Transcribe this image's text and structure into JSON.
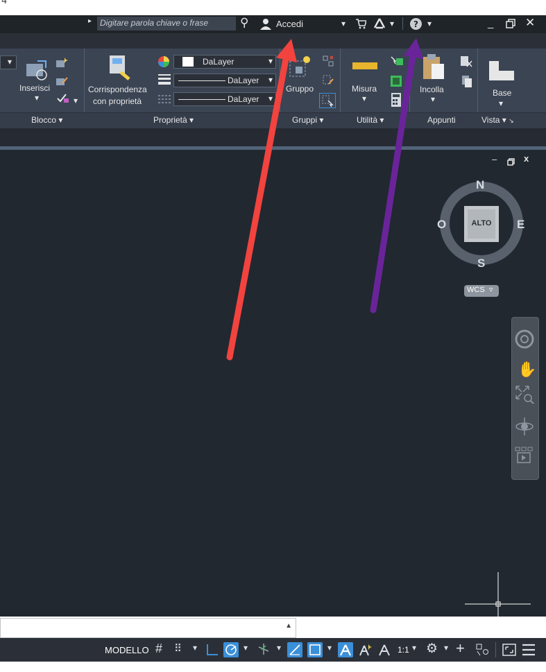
{
  "corner_text": "4",
  "titlebar": {
    "search_placeholder": "Digitare parola chiave o frase",
    "signin_label": "Accedi"
  },
  "ribbon": {
    "insert_label": "Inserisci",
    "match_props_line1": "Corrispondenza",
    "match_props_line2": "con proprietà",
    "layer_color_value": "DaLayer",
    "linetype_value": "DaLayer",
    "lineweight_value": "DaLayer",
    "group_label": "Gruppo",
    "measure_label": "Misura",
    "paste_label": "Incolla",
    "base_label": "Base"
  },
  "panels": {
    "block": "Blocco",
    "properties": "Proprietà",
    "groups": "Gruppi",
    "utilities": "Utilità",
    "clipboard": "Appunti",
    "view": "Vista"
  },
  "viewcube": {
    "north": "N",
    "south": "S",
    "east": "E",
    "west": "O",
    "face": "ALTO",
    "ucs": "WCS"
  },
  "statusbar": {
    "model_label": "MODELLO",
    "scale_label": "1:1"
  },
  "colors": {
    "red_arrow": "#f2433f",
    "purple_arrow": "#6a249a",
    "accent_blue": "#3b8fd8"
  }
}
